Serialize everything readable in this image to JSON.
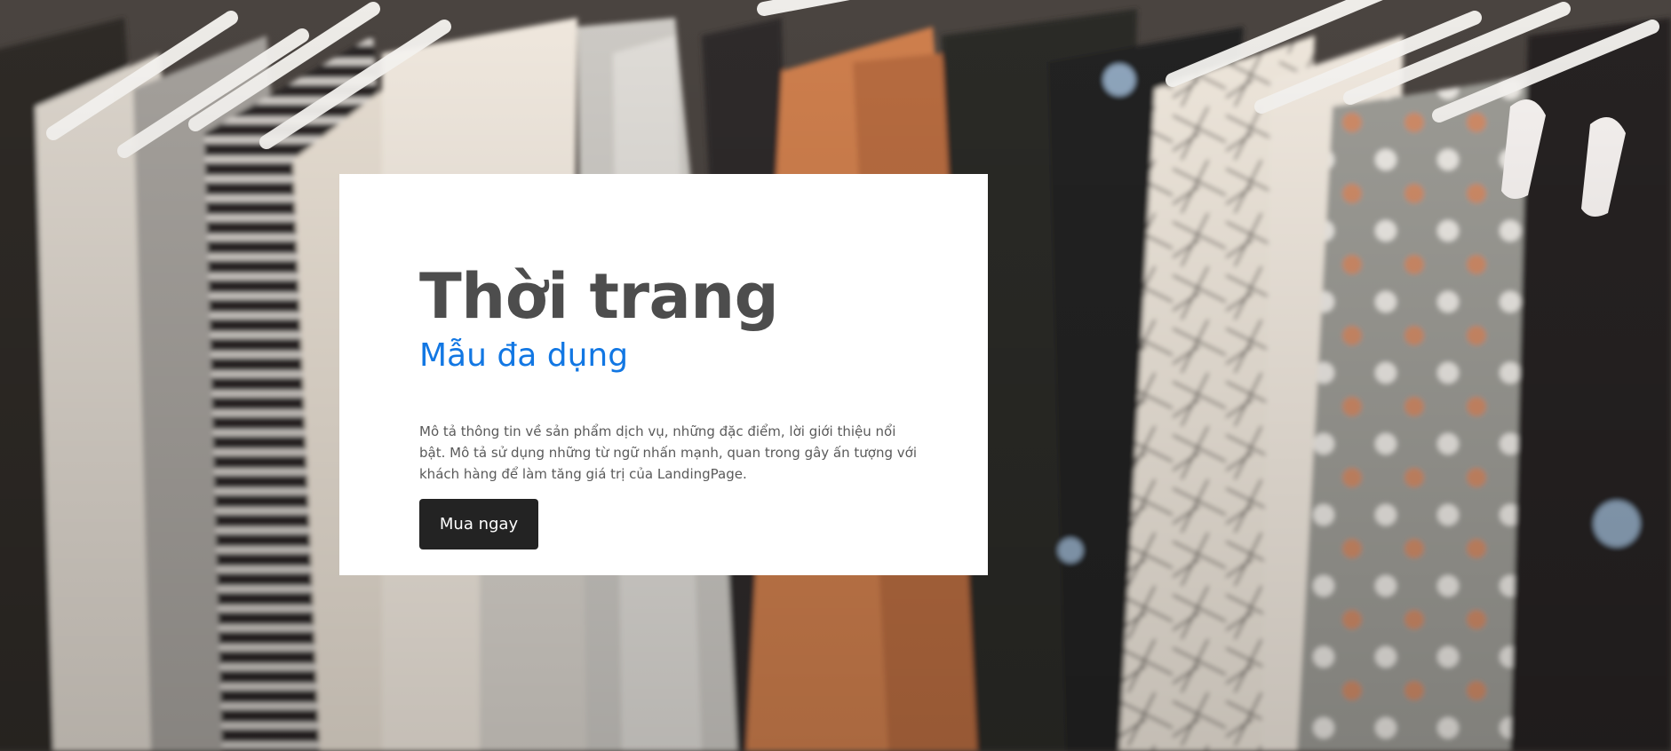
{
  "hero": {
    "background": {
      "subject": "clothing rack with shirts on hangers",
      "colors": {
        "dark": "#2b2826",
        "cream": "#efe6da",
        "grey": "#9b9a95",
        "orange": "#cc7b4a",
        "hanger": "#f5f3f1"
      }
    },
    "card": {
      "title": "Thời trang",
      "subtitle": "Mẫu đa dụng",
      "description": "Mô tả thông tin về sản phẩm dịch vụ, những đặc điểm, lời giới thiệu nổi bật. Mô tả sử dụng những từ ngữ nhấn mạnh, quan trong gây ấn tượng với khách hàng để làm tăng giá trị của LandingPage.",
      "button_label": "Mua ngay",
      "accent_color": "#1277e3",
      "title_color": "#4d4d4d",
      "button_color": "#232323"
    }
  }
}
